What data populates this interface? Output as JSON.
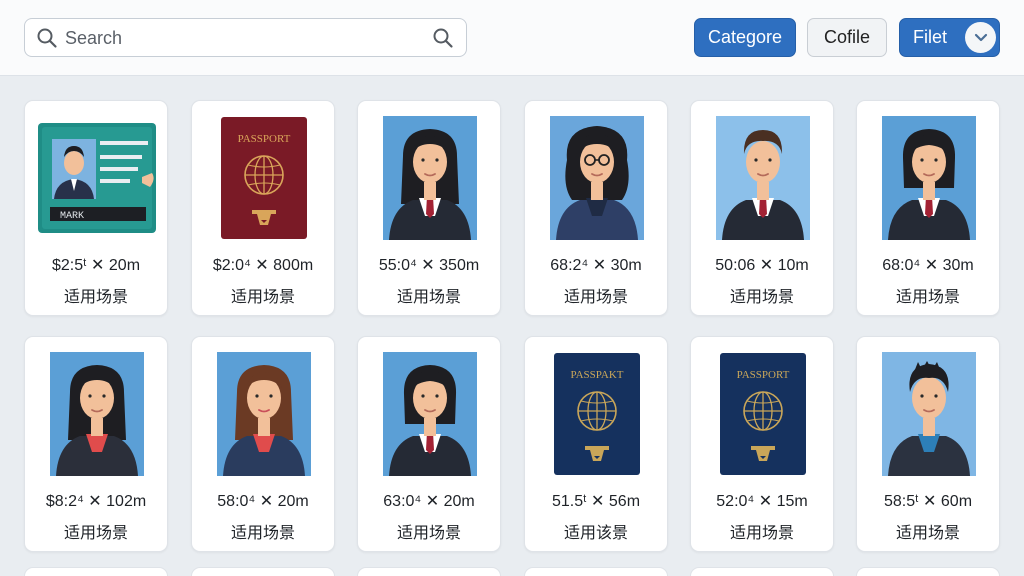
{
  "search": {
    "placeholder": "Search"
  },
  "toolbar": {
    "category_label": "Categore",
    "profile_label": "Cofile",
    "filter_label": "Filet"
  },
  "cards": [
    {
      "type": "id-card",
      "size": "$2:5ᵗ ✕ 20m",
      "usage": "适用场景",
      "card_text": "MARK"
    },
    {
      "type": "passport-red",
      "size": "$2:0⁴ ✕ 800m",
      "usage": "适用场景",
      "cover_title": "PASSPORT"
    },
    {
      "type": "photo-female-long",
      "size": "55:0⁴ ✕ 350m",
      "usage": "适用场景"
    },
    {
      "type": "photo-female-glasses",
      "size": "68:2⁴ ✕ 30m",
      "usage": "适用场景"
    },
    {
      "type": "photo-male",
      "size": "50:06 ✕ 10m",
      "usage": "适用场景"
    },
    {
      "type": "photo-female-bob",
      "size": "68:0⁴ ✕ 30m",
      "usage": "适用场景"
    },
    {
      "type": "photo-female-red",
      "size": "$8:2⁴ ✕ 102m",
      "usage": "适用场景"
    },
    {
      "type": "photo-female-brown",
      "size": "58:0⁴ ✕ 20m",
      "usage": "适用场景"
    },
    {
      "type": "photo-female-tie",
      "size": "63:0⁴ ✕ 20m",
      "usage": "适用场景"
    },
    {
      "type": "passport-blue",
      "size": "51.5ᵗ ✕ 56m",
      "usage": "适用该景",
      "cover_title": "PASSPAKT"
    },
    {
      "type": "passport-blue",
      "size": "52:0⁴ ✕ 15m",
      "usage": "适用场景",
      "cover_title": "PASSPORT"
    },
    {
      "type": "photo-male-casual",
      "size": "58:5ᵗ ✕ 60m",
      "usage": "适用场景"
    }
  ]
}
